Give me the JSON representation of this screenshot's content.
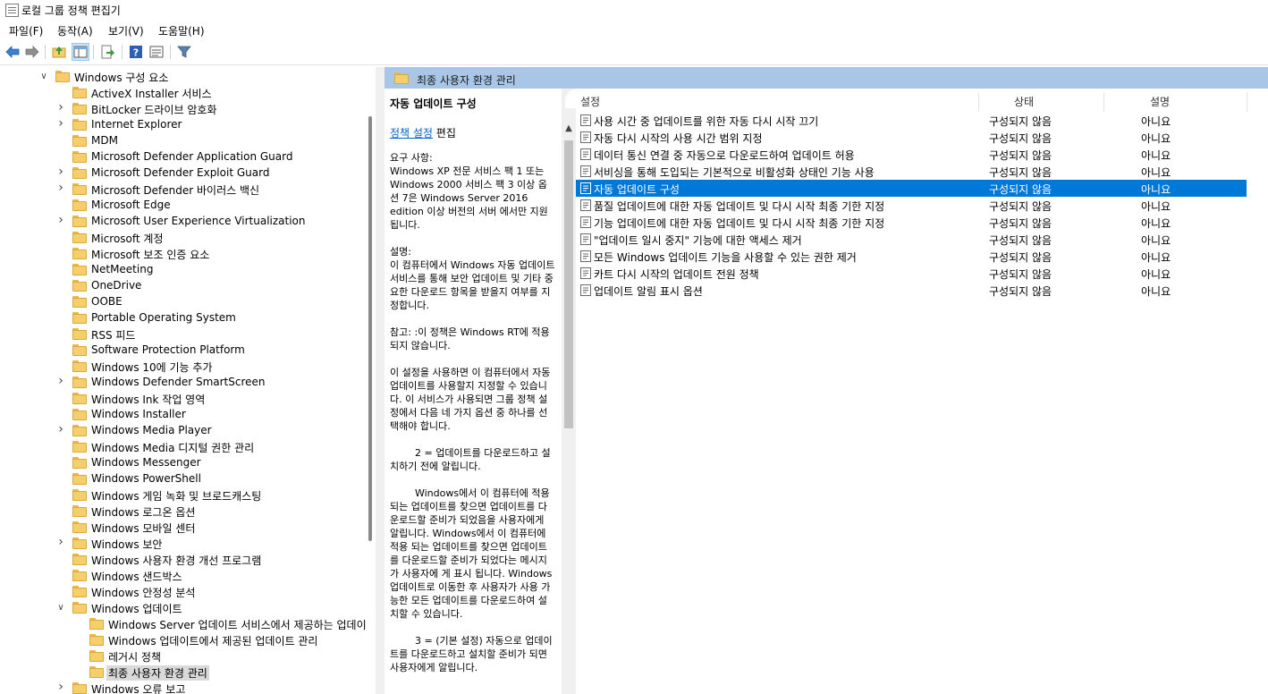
{
  "window": {
    "title": "로컬 그룹 정책 편집기"
  },
  "menubar": {
    "items": [
      "파일(F)",
      "동작(A)",
      "보기(V)",
      "도움말(H)"
    ]
  },
  "toolbar": {
    "icons": [
      "back-arrow-icon",
      "forward-arrow-icon",
      "up-folder-icon",
      "show-hide-tree-icon",
      "export-list-icon",
      "help-icon",
      "properties-icon",
      "filter-icon"
    ]
  },
  "tree": {
    "items": [
      {
        "label": "Windows 구성 요소",
        "expander": "expanded"
      },
      {
        "label": "ActiveX Installer 서비스",
        "expander": "none"
      },
      {
        "label": "BitLocker 드라이브 암호화",
        "expander": "collapsed"
      },
      {
        "label": "Internet Explorer",
        "expander": "collapsed"
      },
      {
        "label": "MDM",
        "expander": "none"
      },
      {
        "label": "Microsoft Defender Application Guard",
        "expander": "none"
      },
      {
        "label": "Microsoft Defender Exploit Guard",
        "expander": "collapsed"
      },
      {
        "label": "Microsoft Defender 바이러스 백신",
        "expander": "collapsed"
      },
      {
        "label": "Microsoft Edge",
        "expander": "none"
      },
      {
        "label": "Microsoft User Experience Virtualization",
        "expander": "collapsed"
      },
      {
        "label": "Microsoft 계정",
        "expander": "none"
      },
      {
        "label": "Microsoft 보조 인증 요소",
        "expander": "none"
      },
      {
        "label": "NetMeeting",
        "expander": "none"
      },
      {
        "label": "OneDrive",
        "expander": "none"
      },
      {
        "label": "OOBE",
        "expander": "none"
      },
      {
        "label": "Portable Operating System",
        "expander": "none"
      },
      {
        "label": "RSS 피드",
        "expander": "none"
      },
      {
        "label": "Software Protection Platform",
        "expander": "none"
      },
      {
        "label": "Windows 10에 기능 추가",
        "expander": "none"
      },
      {
        "label": "Windows Defender SmartScreen",
        "expander": "collapsed"
      },
      {
        "label": "Windows Ink 작업 영역",
        "expander": "none"
      },
      {
        "label": "Windows Installer",
        "expander": "none"
      },
      {
        "label": "Windows Media Player",
        "expander": "collapsed"
      },
      {
        "label": "Windows Media 디지털 권한 관리",
        "expander": "none"
      },
      {
        "label": "Windows Messenger",
        "expander": "none"
      },
      {
        "label": "Windows PowerShell",
        "expander": "none"
      },
      {
        "label": "Windows 게임 녹화 및 브로드캐스팅",
        "expander": "none"
      },
      {
        "label": "Windows 로그온 옵션",
        "expander": "none"
      },
      {
        "label": "Windows 모바일 센터",
        "expander": "none"
      },
      {
        "label": "Windows 보안",
        "expander": "collapsed"
      },
      {
        "label": "Windows 사용자 환경 개선 프로그램",
        "expander": "none"
      },
      {
        "label": "Windows 샌드박스",
        "expander": "none"
      },
      {
        "label": "Windows 안정성 분석",
        "expander": "none"
      },
      {
        "label": "Windows 업데이트",
        "expander": "expanded"
      },
      {
        "label": "Windows Server 업데이트 서비스에서 제공하는 업데이",
        "expander": "none",
        "child": true
      },
      {
        "label": "Windows 업데이트에서 제공된 업데이트 관리",
        "expander": "none",
        "child": true
      },
      {
        "label": "레거시 정책",
        "expander": "none",
        "child": true
      },
      {
        "label": "최종 사용자 환경 관리",
        "expander": "none",
        "child": true,
        "selected": true
      },
      {
        "label": "Windows 오류 보고",
        "expander": "collapsed"
      }
    ]
  },
  "right_pane": {
    "header": "최종 사용자 환경 관리",
    "description": {
      "title": "자동 업데이트 구성",
      "link": "정책 설정",
      "link_suffix": " 편집",
      "body": "요구 사항:\nWindows XP 전문 서비스 팩 1 또는 Windows 2000 서비스 팩 3 이상 옵션 7은 Windows Server 2016 edition 이상 버전의 서버 에서만 지원됩니다.\n\n설명:\n이 컴퓨터에서 Windows 자동 업데이트 서비스를 통해 보안 업데이트 및 기타 중요한 다운로드 항목을 받을지 여부를 지정합니다.\n\n참고: :이 정책은 Windows RT에 적용되지 않습니다.\n\n이 설정을 사용하면 이 컴퓨터에서 자동 업데이트를 사용할지 지정할 수 있습니다. 이 서비스가 사용되면 그룹 정책 설정에서 다음 네 가지 옵션 중 하나를 선택해야 합니다.\n\n        2 = 업데이트를 다운로드하고 설치하기 전에 알립니다.\n\n        Windows에서 이 컴퓨터에 적용되는 업데이트를 찾으면 업데이트를 다운로드할 준비가 되었음을 사용자에게 알립니다. Windows에서 이 컴퓨터에 적용 되는 업데이트를 찾으면 업데이트를 다운로드할 준비가 되었다는 메시지가 사용자에 게 표시 됩니다. Windows 업데이트로 이동한 후 사용자가 사용 가능한 모든 업데이트를 다운로드하여 설치할 수 있습니다.\n\n        3 = (기본 설정) 자동으로 업데이트를 다운로드하고 설치할 준비가 되면 사용자에게 알립니다."
    },
    "columns": {
      "setting": "설정",
      "state": "상태",
      "note": "설명"
    },
    "policies": [
      {
        "name": "사용 시간 중 업데이트를 위한 자동 다시 시작 끄기",
        "state": "구성되지 않음",
        "note": "아니요"
      },
      {
        "name": "자동 다시 시작의 사용 시간 범위 지정",
        "state": "구성되지 않음",
        "note": "아니요"
      },
      {
        "name": "데이터 통신 연결 중 자동으로 다운로드하여 업데이트 허용",
        "state": "구성되지 않음",
        "note": "아니요"
      },
      {
        "name": "서비싱을 통해 도입되는 기본적으로 비활성화 상태인 기능 사용",
        "state": "구성되지 않음",
        "note": "아니요"
      },
      {
        "name": "자동 업데이트 구성",
        "state": "구성되지 않음",
        "note": "아니요",
        "selected": true
      },
      {
        "name": "품질 업데이트에 대한 자동 업데이트 및 다시 시작 최종 기한 지정",
        "state": "구성되지 않음",
        "note": "아니요"
      },
      {
        "name": "기능 업데이트에 대한 자동 업데이트 및 다시 시작 최종 기한 지정",
        "state": "구성되지 않음",
        "note": "아니요"
      },
      {
        "name": "\"업데이트 일시 중지\" 기능에 대한 액세스 제거",
        "state": "구성되지 않음",
        "note": "아니요"
      },
      {
        "name": "모든 Windows 업데이트 기능을 사용할 수 있는 권한 제거",
        "state": "구성되지 않음",
        "note": "아니요"
      },
      {
        "name": "카트 다시 시작의 업데이트 전원 정책",
        "state": "구성되지 않음",
        "note": "아니요"
      },
      {
        "name": "업데이트 알림 표시 옵션",
        "state": "구성되지 않음",
        "note": "아니요"
      }
    ]
  },
  "colors": {
    "header_band": "#a9c6e6",
    "selection": "#0078d7",
    "link": "#0066cc",
    "folder": "#f6ce6c"
  }
}
